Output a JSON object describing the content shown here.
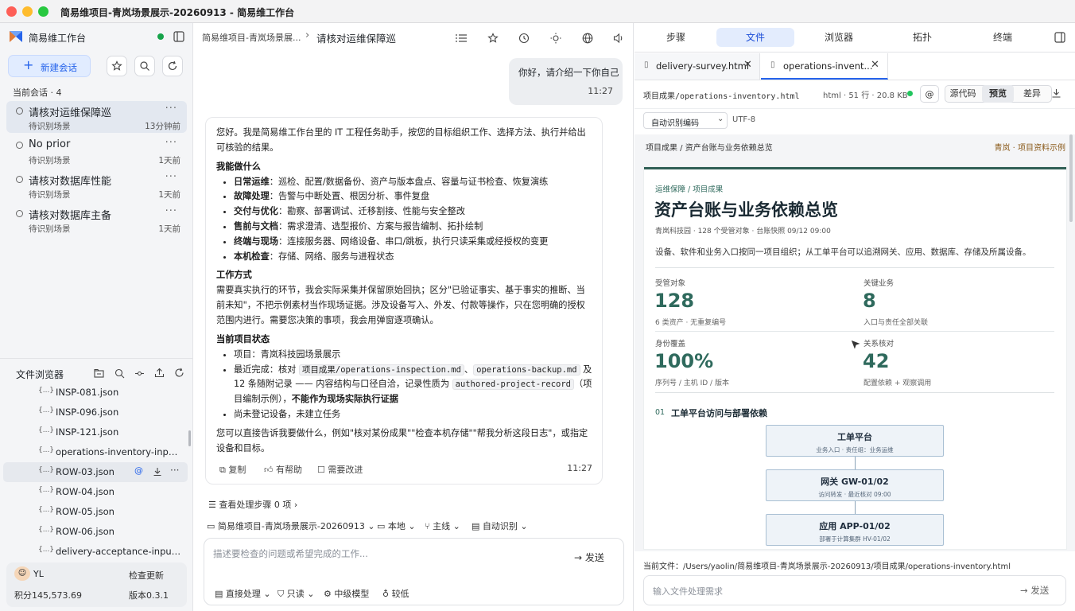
{
  "window": {
    "title": "简易维项目-青岚场景展示-20260913 - 简易维工作台"
  },
  "sidebar": {
    "app_name": "简易维工作台",
    "new_chat_label": "新建会话",
    "section_label": "当前会话 · 4",
    "conversations": [
      {
        "title": "请核对运维保障巡",
        "subtitle": "待识别场景",
        "time": "13分钟前",
        "active": true
      },
      {
        "title": "No prior",
        "subtitle": "待识别场景",
        "time": "1天前",
        "active": false
      },
      {
        "title": "请核对数据库性能",
        "subtitle": "待识别场景",
        "time": "1天前",
        "active": false
      },
      {
        "title": "请核对数据库主备",
        "subtitle": "待识别场景",
        "time": "1天前",
        "active": false
      }
    ],
    "file_browser": {
      "label": "文件浏览器",
      "files": [
        {
          "name": "INSP-081.json"
        },
        {
          "name": "INSP-096.json"
        },
        {
          "name": "INSP-121.json"
        },
        {
          "name": "operations-inventory-inputs.json"
        },
        {
          "name": "ROW-03.json",
          "selected": true
        },
        {
          "name": "ROW-04.json"
        },
        {
          "name": "ROW-05.json"
        },
        {
          "name": "ROW-06.json"
        },
        {
          "name": "delivery-acceptance-inputs.json"
        }
      ]
    },
    "user": {
      "name": "YL",
      "points": "积分145,573.69",
      "update_label": "检查更新",
      "version": "版本0.3.1"
    }
  },
  "chat": {
    "breadcrumb_project": "简易维项目-青岚场景展...",
    "breadcrumb_sep": "›",
    "breadcrumb_title": "请核对运维保障巡",
    "user_message": {
      "text": "你好，请介绍一下你自己",
      "time": "11:27"
    },
    "assistant": {
      "intro": "您好。我是简易维工作台里的 IT 工程任务助手，按您的目标组织工作、选择方法、执行并给出可核验的结果。",
      "can_do_heading": "我能做什么",
      "can_do": [
        {
          "k": "日常运维",
          "v": "：巡检、配置/数据备份、资产与版本盘点、容量与证书检查、恢复演练"
        },
        {
          "k": "故障处理",
          "v": "：告警与中断处置、根因分析、事件复盘"
        },
        {
          "k": "交付与优化",
          "v": "：勘察、部署调试、迁移割接、性能与安全整改"
        },
        {
          "k": "售前与文档",
          "v": "：需求澄清、选型报价、方案与报告编制、拓扑绘制"
        },
        {
          "k": "终端与现场",
          "v": "：连接服务器、网络设备、串口/跳板，执行只读采集或经授权的变更"
        },
        {
          "k": "本机检查",
          "v": "：存储、网络、服务与进程状态"
        }
      ],
      "method_heading": "工作方式",
      "method_text": "需要真实执行的环节，我会实际采集并保留原始回执；区分\"已验证事实、基于事实的推断、当前未知\"，不把示例素材当作现场证据。涉及设备写入、外发、付款等操作，只在您明确的授权范围内进行。需要您决策的事项，我会用弹窗逐项确认。",
      "status_heading": "当前项目状态",
      "status_project": "项目：青岚科技园场景展示",
      "status_recent_prefix": "最近完成：核对 ",
      "status_code1": "项目成果/operations-inspection.md",
      "status_sep": "、",
      "status_code2": "operations-backup.md",
      "status_mid": " 及 12 条随附记录 —— 内容结构与口径自洽，记录性质为 ",
      "status_code3": "authored-project-record",
      "status_tail": "（项目编制示例），",
      "status_bold": "不能作为现场实际执行证据",
      "status_pending": "尚未登记设备，未建立任务",
      "closing": "您可以直接告诉我要做什么，例如\"核对某份成果\"\"检查本机存储\"\"帮我分析这段日志\"，或指定设备和目标。",
      "copy_label": "复制",
      "helpful_label": "有帮助",
      "improve_label": "需要改进",
      "time": "11:27"
    },
    "steps_label": "查看处理步骤 0 项 ›",
    "context": {
      "project": "简易维项目-青岚场景展示-20260913",
      "location": "本地",
      "branch": "主线",
      "mode": "自动识别"
    },
    "input_placeholder": "描述要检查的问题或希望完成的工作...",
    "send_label": "发送",
    "options": {
      "process": "直接处理",
      "permission": "只读",
      "model": "中级模型",
      "effort": "较低"
    }
  },
  "right": {
    "tabs": [
      "步骤",
      "文件",
      "浏览器",
      "拓扑",
      "终端"
    ],
    "active_tab": "文件",
    "file_tabs": [
      {
        "name": "delivery-survey.html"
      },
      {
        "name": "operations-invent..."
      }
    ],
    "path": "项目成果/operations-inventory.html",
    "meta": "html · 51 行 · 20.8 KB",
    "status_color": "#22c55e",
    "mention_label": "@",
    "view_modes": [
      "源代码",
      "预览",
      "差异"
    ],
    "active_view": "预览",
    "encoding_select": "自动识别编码",
    "encoding_value": "UTF-8",
    "doc_breadcrumb": "项目成果 / 资产台账与业务依赖总览",
    "doc_tag": "青岚 · 项目资料示例",
    "preview": {
      "kicker": "运维保障 / 项目成果",
      "title": "资产台账与业务依赖总览",
      "meta": "青岚科技园 · 128 个受管对象 · 台账快照 09/12 09:00",
      "desc": "设备、软件和业务入口按同一项目组织；从工单平台可以追溯网关、应用、数据库、存储及所属设备。",
      "stats": [
        {
          "label": "受管对象",
          "value": "128",
          "sub": "6 类资产 · 无重复编号"
        },
        {
          "label": "关键业务",
          "value": "8",
          "sub": "入口与责任全部关联"
        },
        {
          "label": "身份覆盖",
          "value": "100%",
          "sub": "序列号 / 主机 ID / 版本"
        },
        {
          "label": "关系核对",
          "value": "42",
          "sub": "配置依赖 + 观察调用"
        }
      ],
      "section_num": "01",
      "section_title": "工单平台访问与部署依赖",
      "nodes": [
        {
          "title": "工单平台",
          "sub": "业务入口 · 责任组：业务运维"
        },
        {
          "title": "网关 GW-01/02",
          "sub": "访问转发 · 最近核对 09:00"
        },
        {
          "title": "应用 APP-01/02",
          "sub": "部署于计算集群 HV-01/02"
        }
      ]
    },
    "current_file_label": "当前文件：",
    "current_file_path": "/Users/yaolin/简易维项目-青岚场景展示-20260913/项目成果/operations-inventory.html",
    "input_placeholder": "输入文件处理需求",
    "send_label": "发送"
  },
  "colors": {
    "accent": "#2563eb",
    "doc_green": "#2f6a5d",
    "online": "#22c55e"
  }
}
